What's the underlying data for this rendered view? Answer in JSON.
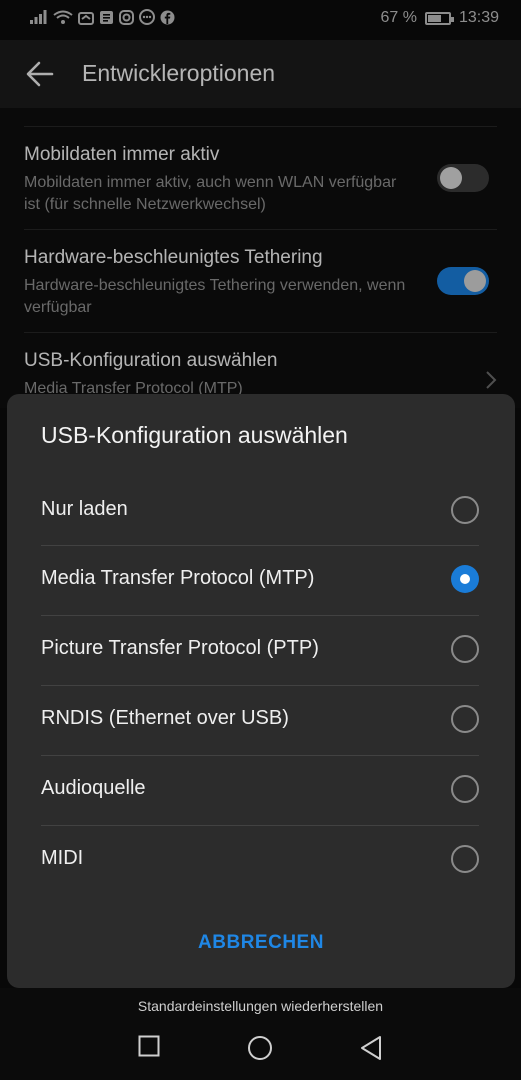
{
  "status_bar": {
    "battery_percent": "67 %",
    "time": "13:39",
    "battery_level": 0.67,
    "icons": [
      "signal-icon",
      "wifi-icon",
      "alarm-icon",
      "message-icon",
      "instagram-icon",
      "chat-icon",
      "facebook-icon"
    ]
  },
  "app_bar": {
    "title": "Entwickleroptionen"
  },
  "settings": [
    {
      "title": "Mobildaten immer aktiv",
      "subtitle": "Mobildaten immer aktiv, auch wenn WLAN verfügbar ist (für schnelle Netzwerkwechsel)",
      "toggle": "off"
    },
    {
      "title": "Hardware-beschleunigtes Tethering",
      "subtitle": "Hardware-beschleunigtes Tethering verwenden, wenn verfügbar",
      "toggle": "on"
    },
    {
      "title": "USB-Konfiguration auswählen",
      "subtitle": "Media Transfer Protocol (MTP)"
    }
  ],
  "dialog": {
    "title": "USB-Konfiguration auswählen",
    "options": [
      {
        "label": "Nur laden",
        "selected": false
      },
      {
        "label": "Media Transfer Protocol (MTP)",
        "selected": true
      },
      {
        "label": "Picture Transfer Protocol (PTP)",
        "selected": false
      },
      {
        "label": "RNDIS (Ethernet over USB)",
        "selected": false
      },
      {
        "label": "Audioquelle",
        "selected": false
      },
      {
        "label": "MIDI",
        "selected": false
      }
    ],
    "cancel_label": "ABBRECHEN"
  },
  "footer": {
    "reset_label": "Standardeinstellungen wiederherstellen"
  },
  "nav_bar": {
    "buttons": [
      "recents-square-icon",
      "home-circle-icon",
      "back-triangle-icon"
    ]
  },
  "colors": {
    "accent": "#1a7cd8",
    "dialog_bg": "#2c2c2c",
    "app_bar_bg": "#1b1b1b"
  }
}
